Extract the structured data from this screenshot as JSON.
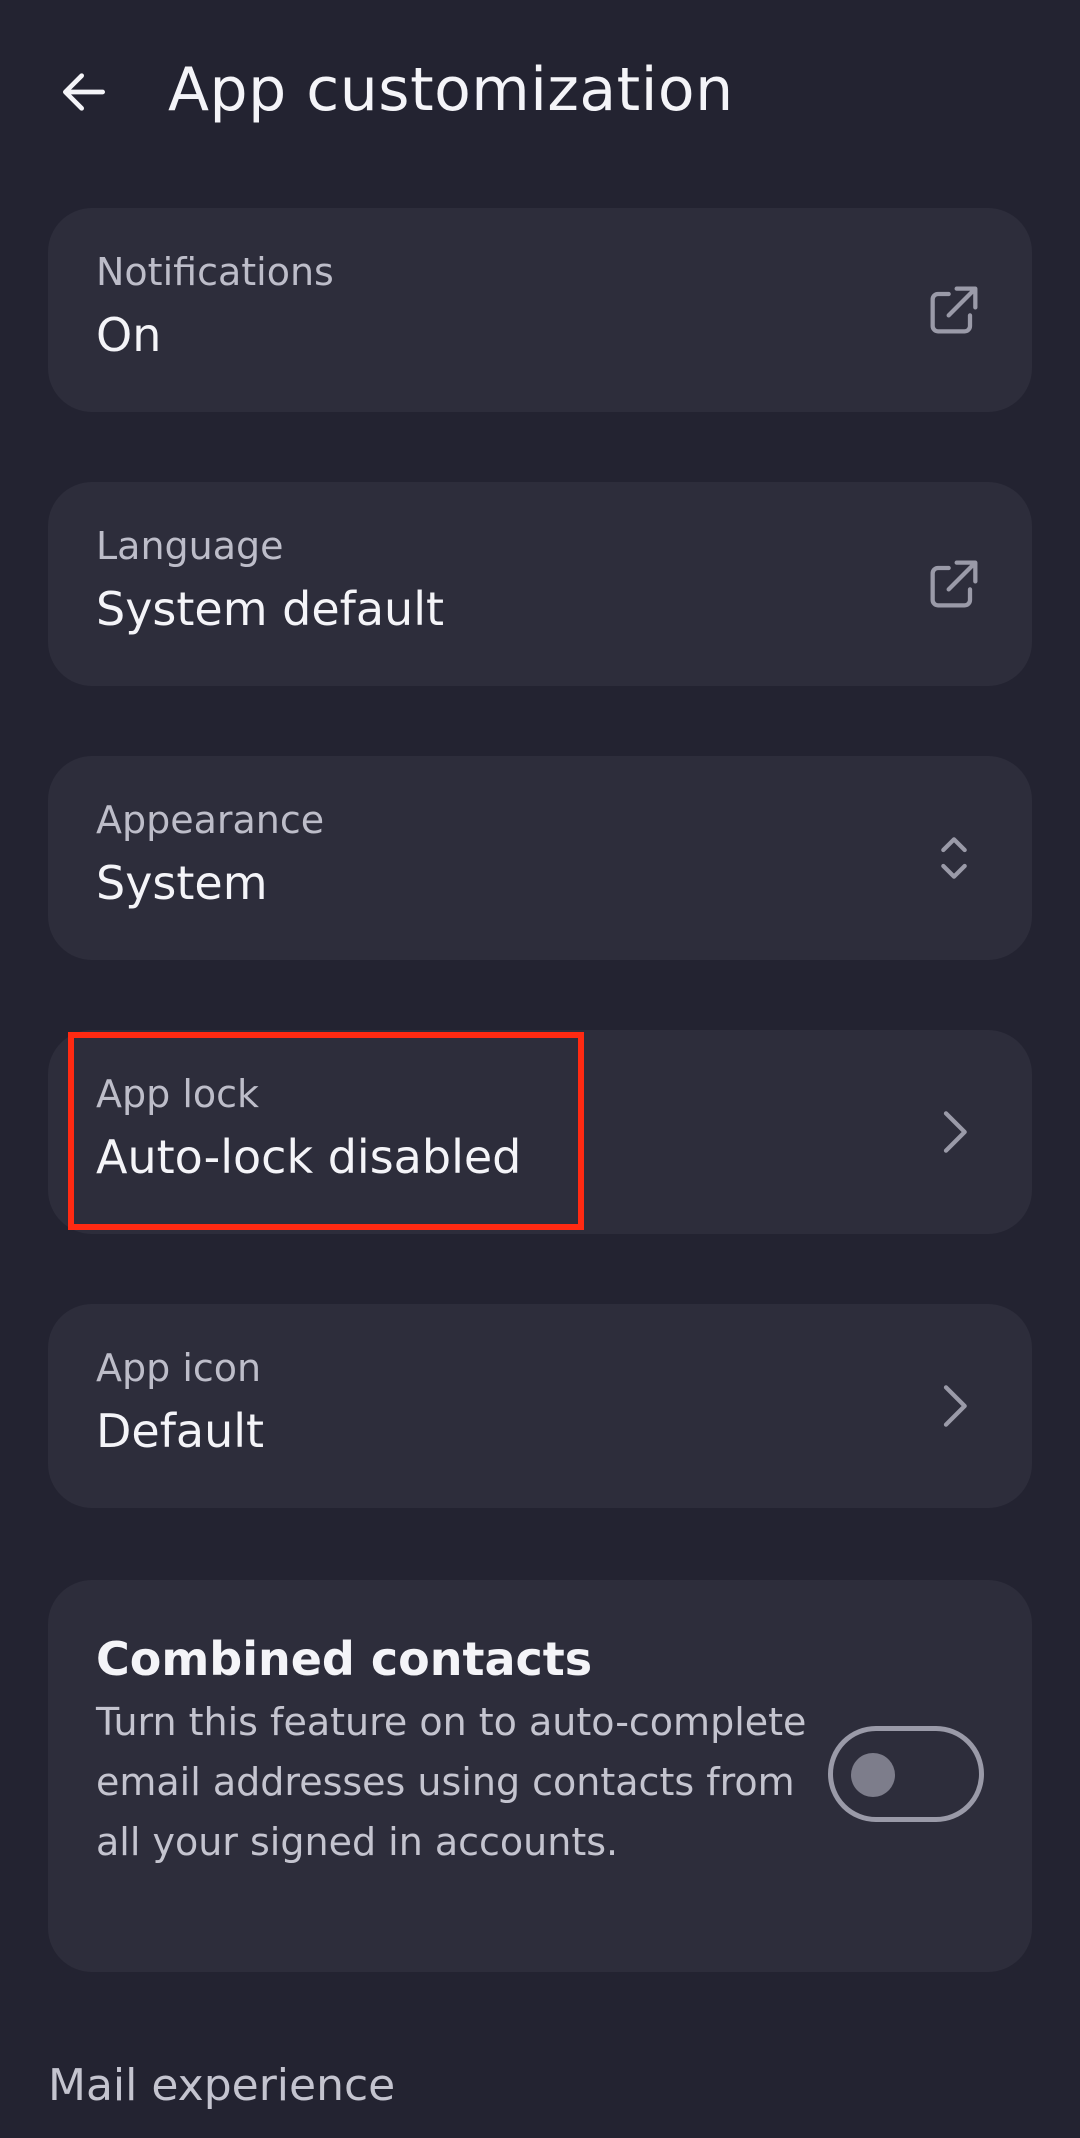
{
  "header": {
    "title": "App customization",
    "back_icon": "arrow-left-icon"
  },
  "settings": {
    "notifications": {
      "label": "Notifications",
      "value": "On",
      "icon": "external-link-icon"
    },
    "language": {
      "label": "Language",
      "value": "System default",
      "icon": "external-link-icon"
    },
    "appearance": {
      "label": "Appearance",
      "value": "System",
      "icon": "chevron-up-down-icon"
    },
    "app_lock": {
      "label": "App lock",
      "value": "Auto-lock disabled",
      "icon": "chevron-right-icon"
    },
    "app_icon": {
      "label": "App icon",
      "value": "Default",
      "icon": "chevron-right-icon"
    }
  },
  "combined_contacts": {
    "title": "Combined contacts",
    "description": "Turn this feature on to auto-complete email addresses using contacts from all your signed in accounts.",
    "enabled": false
  },
  "sections": {
    "mail_experience": "Mail experience"
  },
  "colors": {
    "background": "#232331",
    "card": "#2d2d3b",
    "highlight": "#ff2a12"
  }
}
